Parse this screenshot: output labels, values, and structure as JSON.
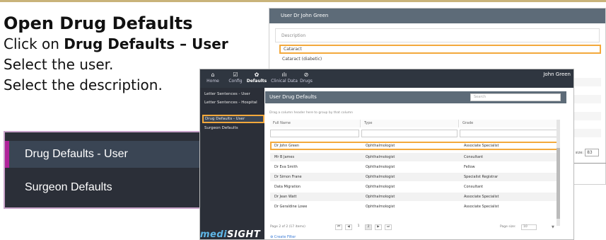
{
  "instructions": {
    "title": "Open Drug Defaults",
    "line1_prefix": "Click on ",
    "line1_bold": "Drug Defaults – User",
    "line2": "Select the user.",
    "line3": "Select the description."
  },
  "zoom": {
    "item1": "Drug Defaults - User",
    "item2": "Surgeon Defaults"
  },
  "back_screen": {
    "header": "User Dr John Green",
    "description_label": "Description",
    "row1": "Cataract",
    "row2": "Cataract (diabetic)",
    "page_size_label": "Page size:",
    "page_size_value": "83"
  },
  "nav": {
    "items": [
      {
        "icon": "⌂",
        "label": "Home"
      },
      {
        "icon": "☑",
        "label": "Config"
      },
      {
        "icon": "✿",
        "label": "Defaults"
      },
      {
        "icon": "ılı",
        "label": "Clinical Data"
      },
      {
        "icon": "⊘",
        "label": "Drugs"
      }
    ],
    "user": "John Green"
  },
  "sidebar": {
    "items": [
      "Letter Sentences - User",
      "Letter Sentences - Hospital",
      "Drug Defaults - User",
      "Surgeon Defaults"
    ],
    "logo_a": "medi",
    "logo_b": "SIGHT"
  },
  "main": {
    "title": "User Drug Defaults",
    "search_placeholder": "Search",
    "group_hint": "Drag a column header here to group by that column",
    "columns": [
      "Full Name",
      "Type",
      "Grade"
    ],
    "rows": [
      [
        "Dr John Green",
        "Ophthalmologist",
        "Associate Specialist"
      ],
      [
        "Mr B James",
        "Ophthalmologist",
        "Consultant"
      ],
      [
        "Dr Eva Smith",
        "Ophthalmologist",
        "Fellow"
      ],
      [
        "Dr Simon Frane",
        "Ophthalmologist",
        "Specialist Registrar"
      ],
      [
        "Data Migration",
        "Ophthalmologist",
        "Consultant"
      ],
      [
        "Dr Jean Watt",
        "Ophthalmologist",
        "Associate Specialist"
      ],
      [
        "Dr Geraldine Lowe",
        "Ophthalmologist",
        "Associate Specialist"
      ]
    ],
    "pager_info": "Page 2 of 2 (17 items)",
    "pager_buttons": [
      "⏮",
      "◀",
      "1",
      "2",
      "▶",
      "⏭"
    ],
    "page_size_label": "Page size:",
    "page_size_value": "10",
    "create_link": "⊕ Create Filter"
  }
}
